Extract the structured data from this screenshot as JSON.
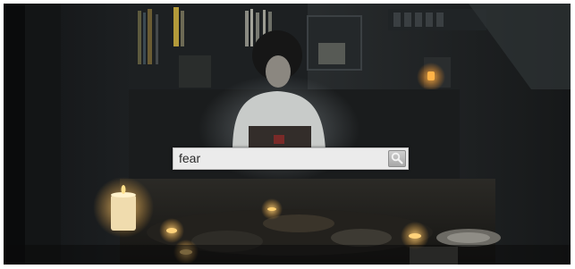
{
  "search": {
    "value": "fear",
    "button_icon": "magnifier-icon"
  },
  "colors": {
    "search_field_background": "#ebebeb",
    "search_button_background": "#b8b8b8",
    "scene_background": "#0d0f10"
  }
}
